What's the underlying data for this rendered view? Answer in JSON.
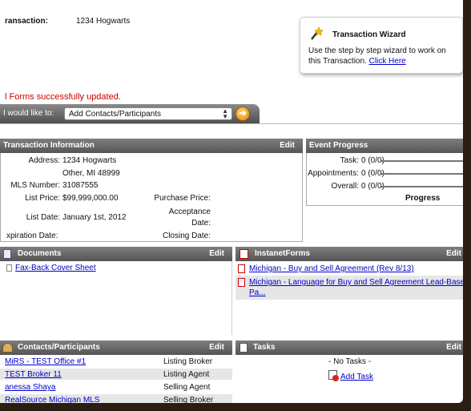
{
  "header": {
    "transaction_label": "ransaction:",
    "transaction_name": "1234 Hogwarts"
  },
  "wizard": {
    "title": "Transaction Wizard",
    "text": "Use the step by step wizard to work on this Transaction.",
    "link": "Click Here"
  },
  "message": "l Forms successfully updated.",
  "action_bar": {
    "label": "I would like to:",
    "selected": "Add Contacts/Participants"
  },
  "info": {
    "title": "Transaction Information",
    "edit": "Edit",
    "address_label": "Address:",
    "address_line1": "1234 Hogwarts",
    "address_line2": "Other, MI 48999",
    "mls_label": "MLS Number:",
    "mls_value": "31087555",
    "list_price_label": "List Price:",
    "list_price_value": "$99,999,000.00",
    "list_date_label": "List Date:",
    "list_date_value": "January 1st, 2012",
    "expiration_label": "xpiration Date:",
    "purchase_price_label": "Purchase Price:",
    "acceptance_label_1": "Acceptance",
    "acceptance_label_2": "Date:",
    "closing_label": "Closing Date:"
  },
  "progress": {
    "title": "Event Progress",
    "task_label": "Task:",
    "task_value": "0 (0/0)",
    "appointments_label": "Appointments:",
    "appointments_value": "0 (0/0)",
    "overall_label": "Overall:",
    "overall_value": "0 (0/0)",
    "footer": "Progress",
    "values": {
      "task": 0,
      "appointments": 0,
      "overall": 0
    }
  },
  "documents": {
    "title": "Documents",
    "edit": "Edit",
    "items": [
      "Fax-Back Cover Sheet"
    ]
  },
  "forms": {
    "title": "InstanetForms",
    "edit": "Edit",
    "items": [
      "Michigan - Buy and Sell Agreement (Rev 8/13)",
      "Michigan - Language for Buy and Sell Agreement Lead-Based",
      "Pa..."
    ]
  },
  "contacts": {
    "title": "Contacts/Participants",
    "edit": "Edit",
    "rows": [
      {
        "name": "MiRS - TEST Office #1",
        "role": "Listing Broker"
      },
      {
        "name": "TEST Broker 11",
        "role": "Listing Agent"
      },
      {
        "name": "anessa Shaya",
        "role": "Selling Agent"
      },
      {
        "name": "RealSource Michigan MLS",
        "role": "Selling Broker"
      }
    ]
  },
  "tasks": {
    "title": "Tasks",
    "edit": "Edit",
    "empty": "- No Tasks -",
    "add": "Add Task"
  },
  "colors": {
    "header_bg": "#666666",
    "link": "#0000cc",
    "message": "#cc0000",
    "go_button": "#f0a020"
  }
}
